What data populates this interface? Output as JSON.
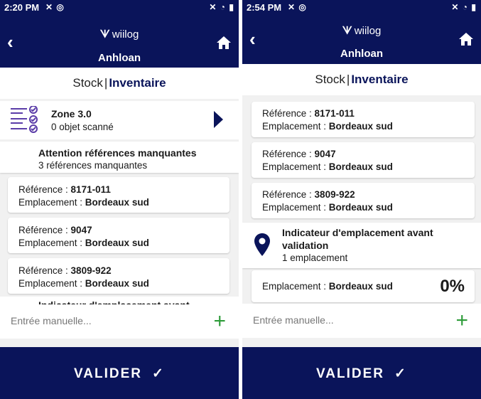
{
  "left": {
    "status": {
      "time": "2:20 PM"
    },
    "appbar": {
      "brand": "wiilog",
      "title": "Anhloan"
    },
    "tabs": {
      "stock": "Stock",
      "separator": "|",
      "inventaire": "Inventaire"
    },
    "zone": {
      "name": "Zone 3.0",
      "count": "0 objet scanné"
    },
    "warning": {
      "title": "Attention références manquantes",
      "subtitle": "3 références manquantes"
    },
    "items": [
      {
        "ref_label": "Référence : ",
        "ref": "8171-011",
        "loc_label": "Emplacement : ",
        "loc": "Bordeaux sud"
      },
      {
        "ref_label": "Référence : ",
        "ref": "9047",
        "loc_label": "Emplacement : ",
        "loc": "Bordeaux sud"
      },
      {
        "ref_label": "Référence : ",
        "ref": "3809-922",
        "loc_label": "Emplacement : ",
        "loc": "Bordeaux sud"
      }
    ],
    "peek": "Indicateur d'emplacement avant",
    "manual": {
      "placeholder": "Entrée manuelle..."
    },
    "validate": {
      "label": "VALIDER",
      "check": "✓"
    }
  },
  "right": {
    "status": {
      "time": "2:54 PM"
    },
    "appbar": {
      "brand": "wiilog",
      "title": "Anhloan"
    },
    "tabs": {
      "stock": "Stock",
      "separator": "|",
      "inventaire": "Inventaire"
    },
    "items": [
      {
        "ref_label": "Référence : ",
        "ref": "8171-011",
        "loc_label": "Emplacement : ",
        "loc": "Bordeaux sud"
      },
      {
        "ref_label": "Référence : ",
        "ref": "9047",
        "loc_label": "Emplacement : ",
        "loc": "Bordeaux sud"
      },
      {
        "ref_label": "Référence : ",
        "ref": "3809-922",
        "loc_label": "Emplacement : ",
        "loc": "Bordeaux sud"
      }
    ],
    "indicator": {
      "title": "Indicateur d'emplacement avant validation",
      "subtitle": "1 emplacement"
    },
    "location": {
      "label": "Emplacement : ",
      "value": "Bordeaux sud",
      "percent": "0%"
    },
    "manual": {
      "placeholder": "Entrée manuelle..."
    },
    "validate": {
      "label": "VALIDER",
      "check": "✓"
    }
  },
  "colors": {
    "primary": "#0a145a",
    "accent_green": "#2e9c3a",
    "background": "#f1f1f1"
  }
}
